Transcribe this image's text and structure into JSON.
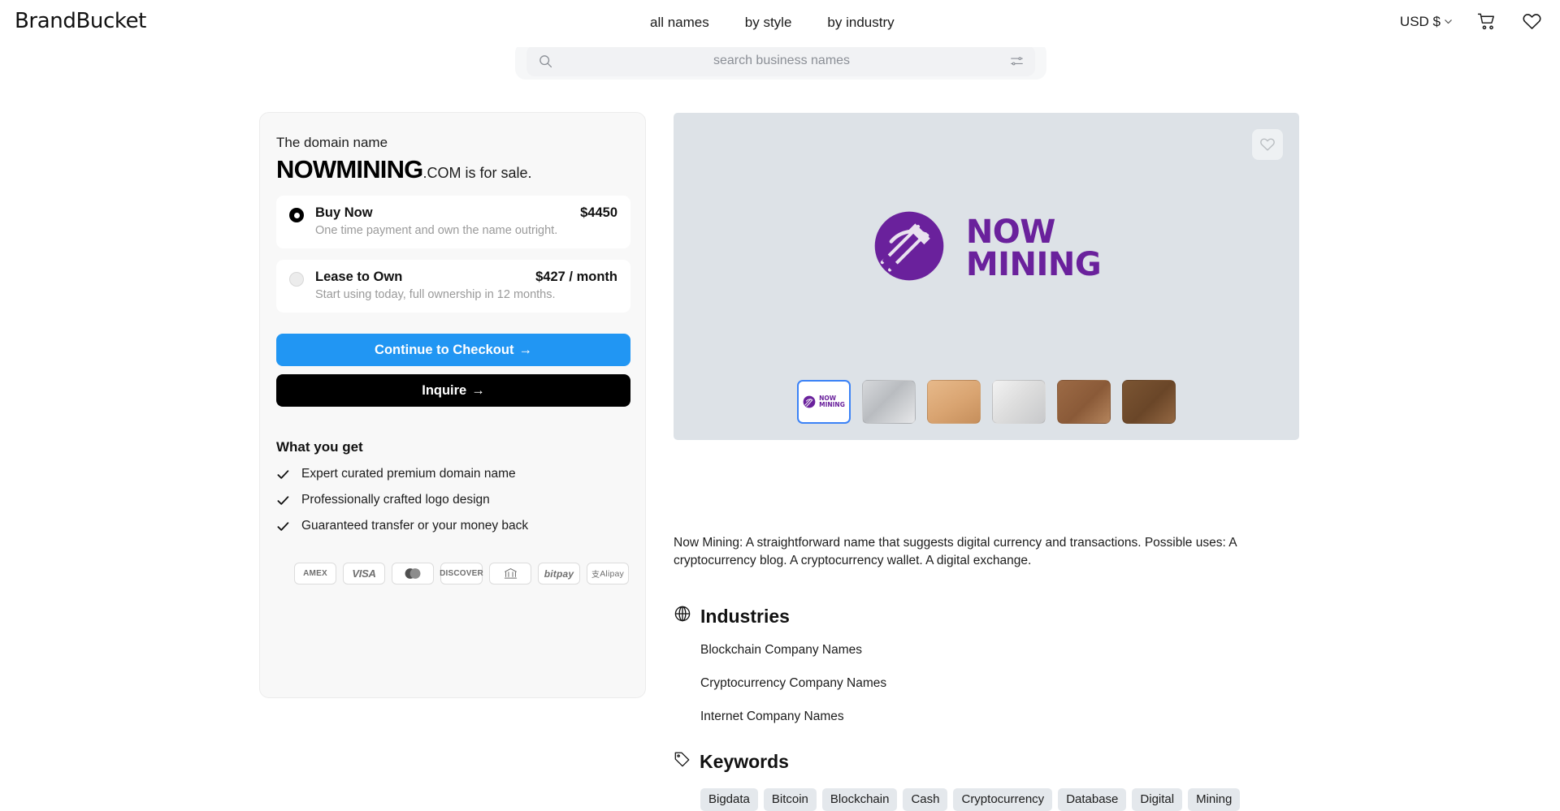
{
  "header": {
    "brand": "BrandBucket",
    "nav": [
      {
        "label": "all names"
      },
      {
        "label": "by style"
      },
      {
        "label": "by industry"
      }
    ],
    "currency": "USD $",
    "cart_icon": "cart-icon",
    "wishlist_icon": "heart-icon"
  },
  "search": {
    "placeholder": "search business names",
    "value": "",
    "search_icon": "search-icon",
    "filter_icon": "sliders-icon"
  },
  "purchase": {
    "intro": "The domain name",
    "domain_name": "NOWMINING",
    "domain_suffix": ".COM is for sale.",
    "options": [
      {
        "title": "Buy Now",
        "subtitle": "One time payment and own the name outright.",
        "price": "$4450",
        "selected": true
      },
      {
        "title": "Lease to Own",
        "subtitle": "Start using today, full ownership in 12 months.",
        "price": "$427 / month",
        "selected": false
      }
    ],
    "checkout_label": "Continue to Checkout",
    "inquire_label": "Inquire",
    "arrow": "→",
    "what_you_get_title": "What you get",
    "benefits": [
      "Expert curated premium domain name",
      "Professionally crafted logo design",
      "Guaranteed transfer or your money back"
    ],
    "payment_methods": [
      "AMEX",
      "VISA",
      "mastercard",
      "DISCOVER",
      "bank",
      "bitpay",
      "Alipay"
    ]
  },
  "preview": {
    "favorite_icon": "heart-icon",
    "logo_line1": "NOW",
    "logo_line2": "MINING",
    "logo_color": "#6a219c",
    "background_color": "#dde2e7",
    "thumbnails": [
      {
        "label": "logo-preview",
        "selected": true
      },
      {
        "label": "mockup-devices",
        "selected": false
      },
      {
        "label": "mockup-business-card",
        "selected": false
      },
      {
        "label": "mockup-desk",
        "selected": false
      },
      {
        "label": "mockup-notebook",
        "selected": false
      },
      {
        "label": "mockup-tablet",
        "selected": false
      }
    ]
  },
  "description": "Now Mining: A straightforward name that suggests digital currency and transactions. Possible uses: A cryptocurrency blog. A cryptocurrency wallet. A digital exchange.",
  "industries": {
    "title": "Industries",
    "icon": "globe-icon",
    "items": [
      "Blockchain Company Names",
      "Cryptocurrency Company Names",
      "Internet Company Names"
    ]
  },
  "keywords": {
    "title": "Keywords",
    "icon": "tag-icon",
    "items": [
      "Bigdata",
      "Bitcoin",
      "Blockchain",
      "Cash",
      "Cryptocurrency",
      "Database",
      "Digital",
      "Mining"
    ]
  }
}
